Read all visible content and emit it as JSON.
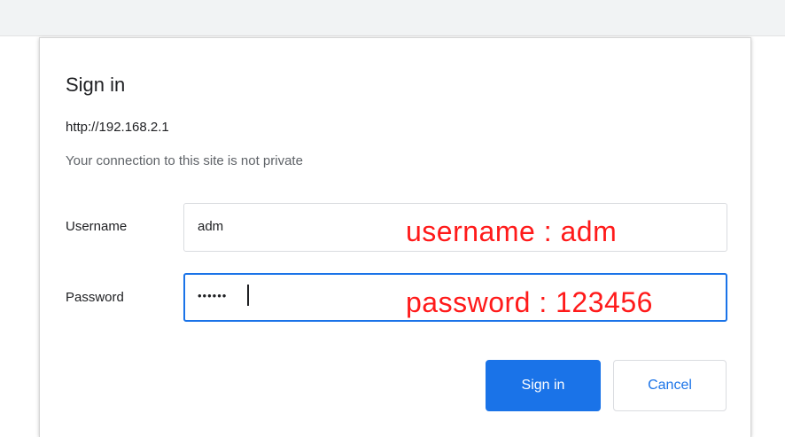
{
  "dialog": {
    "title": "Sign in",
    "url": "http://192.168.2.1",
    "notice": "Your connection to this site is not private"
  },
  "username": {
    "label": "Username",
    "value": "adm"
  },
  "password": {
    "label": "Password",
    "value": "••••••"
  },
  "annotations": {
    "username": "username : adm",
    "password": "password : 123456"
  },
  "buttons": {
    "sign_in": "Sign in",
    "cancel": "Cancel"
  },
  "colors": {
    "primary": "#1a73e8",
    "annotation": "#ff1a1a"
  }
}
